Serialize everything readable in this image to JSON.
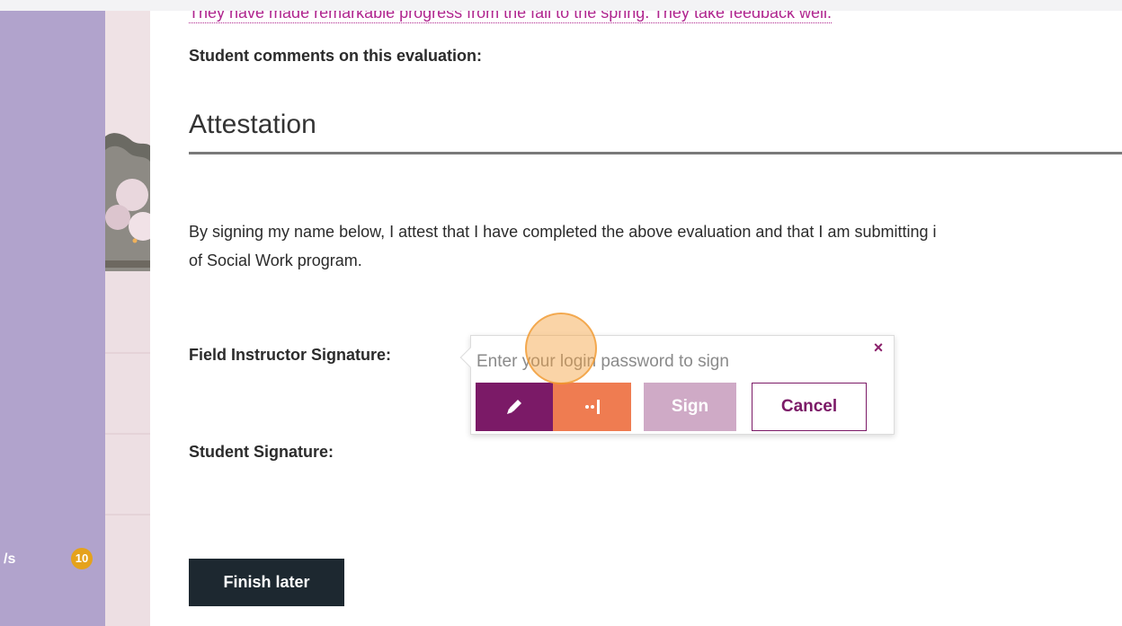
{
  "sidebar": {
    "partial_label": "/s",
    "badge_count": "10",
    "badge_color": "#e5a21c",
    "background_color": "#b1a3cc"
  },
  "main": {
    "top_comment": "They have made remarkable progress from the fall to the spring. They take feedback well.",
    "student_comments_label": "Student comments on this evaluation:",
    "section_title": "Attestation",
    "attest_text_line1": "By signing my name below, I attest that I have completed the above evaluation and that I am submitting i",
    "attest_text_line2": "of Social Work program.",
    "field_instructor_signature_label": "Field Instructor Signature:",
    "student_signature_label": "Student Signature:",
    "finish_later_label": "Finish later"
  },
  "sign_popover": {
    "password_placeholder": "Enter your login password to sign",
    "close_icon": "close-icon",
    "pen_icon": "pen-icon",
    "password_dots_icon": "password-dots-icon",
    "sign_label": "Sign",
    "cancel_label": "Cancel",
    "pen_color": "#7b1a67",
    "key_color": "#ef7c51",
    "sign_color": "#cfaac6"
  }
}
